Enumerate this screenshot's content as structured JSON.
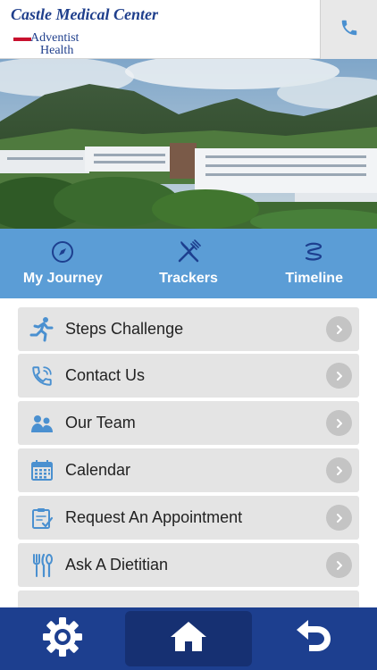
{
  "header": {
    "org_name": "Castle Medical Center",
    "brand_line1": "Adventist",
    "brand_line2": "Health",
    "phone_icon": "phone-icon"
  },
  "hero": {
    "image": "hospital-with-mountains-photo"
  },
  "nav": {
    "items": [
      {
        "label": "My Journey",
        "icon": "compass-icon"
      },
      {
        "label": "Trackers",
        "icon": "fork-knife-icon"
      },
      {
        "label": "Timeline",
        "icon": "timeline-icon"
      }
    ]
  },
  "menu": {
    "items": [
      {
        "label": "Steps Challenge",
        "icon": "running-person-icon"
      },
      {
        "label": "Contact Us",
        "icon": "phone-icon"
      },
      {
        "label": "Our Team",
        "icon": "people-icon"
      },
      {
        "label": "Calendar",
        "icon": "calendar-icon"
      },
      {
        "label": "Request An Appointment",
        "icon": "clipboard-check-icon"
      },
      {
        "label": "Ask A Dietitian",
        "icon": "utensils-icon"
      }
    ]
  },
  "footer": {
    "settings_icon": "gear-icon",
    "home_icon": "home-icon",
    "back_icon": "back-arrow-icon"
  },
  "colors": {
    "brand_blue": "#1f3f8c",
    "nav_blue": "#5b9dd6",
    "footer_blue": "#1d3f8f",
    "icon_blue": "#4a90d0",
    "row_bg": "#e4e4e4"
  }
}
